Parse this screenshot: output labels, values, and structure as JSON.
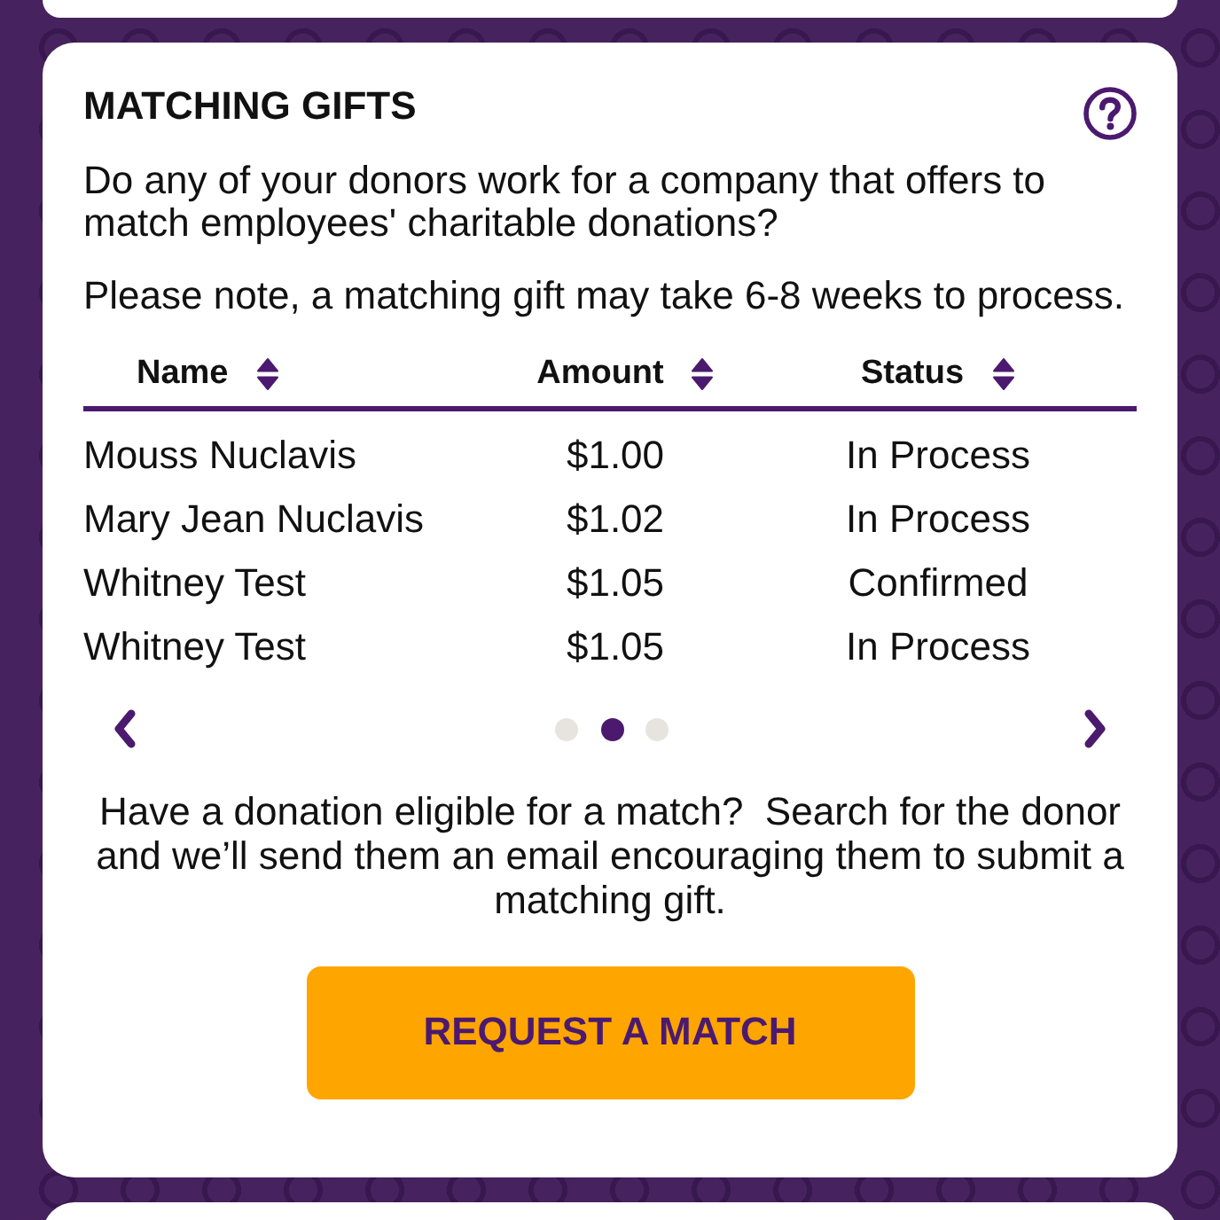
{
  "card": {
    "title": "MATCHING GIFTS",
    "paragraphs": [
      "Do any of your donors work for a company that offers to match employees' charitable donations?",
      "Please note, a matching gift may take 6-8 weeks to process."
    ]
  },
  "table": {
    "columns": [
      {
        "label": "Name",
        "sortable": true
      },
      {
        "label": "Amount",
        "sortable": true
      },
      {
        "label": "Status",
        "sortable": true
      }
    ],
    "rows": [
      {
        "name": "Mouss Nuclavis",
        "amount": "$1.00",
        "status": "In Process"
      },
      {
        "name": "Mary Jean Nuclavis",
        "amount": "$1.02",
        "status": "In Process"
      },
      {
        "name": "Whitney Test",
        "amount": "$1.05",
        "status": "Confirmed"
      },
      {
        "name": "Whitney Test",
        "amount": "$1.05",
        "status": "In Process"
      }
    ]
  },
  "pagination": {
    "pages": [
      {
        "selected": false
      },
      {
        "selected": true
      },
      {
        "selected": false
      }
    ]
  },
  "request_match": {
    "text": "Have a donation eligible for a match?  Search for the donor and we’ll send them an email encouraging them to submit a matching gift.",
    "button": "REQUEST A MATCH"
  }
}
